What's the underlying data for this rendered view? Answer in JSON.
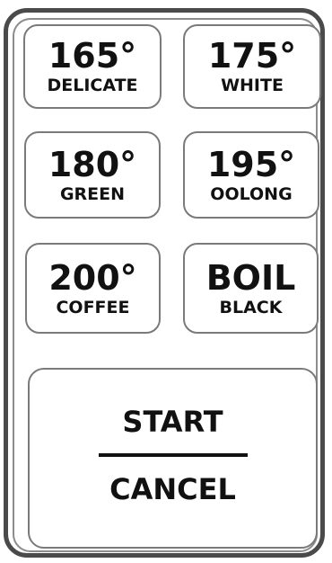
{
  "buttons": [
    {
      "temp": "165°",
      "label": "DELICATE"
    },
    {
      "temp": "175°",
      "label": "WHITE"
    },
    {
      "temp": "180°",
      "label": "GREEN"
    },
    {
      "temp": "195°",
      "label": "OOLONG"
    },
    {
      "temp": "200°",
      "label": "COFFEE"
    },
    {
      "temp": "BOIL",
      "label": "BLACK"
    }
  ],
  "controls": {
    "start_label": "START",
    "cancel_label": "CANCEL"
  },
  "colors": {
    "outer_border": "#4a4a4a",
    "inner_border": "#8c8c8c",
    "button_border": "#7a7a7a",
    "text": "#111111"
  }
}
